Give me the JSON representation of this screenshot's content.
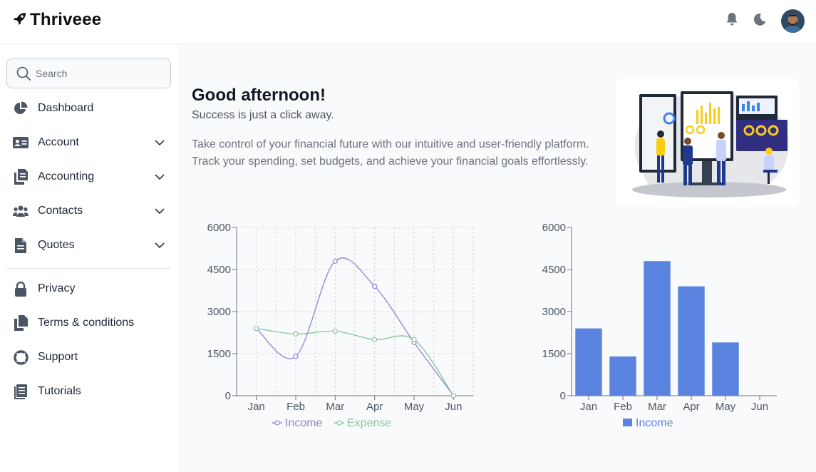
{
  "header": {
    "brand": "Thriveee",
    "icons": [
      "rocket-icon",
      "bell-icon",
      "moon-icon"
    ]
  },
  "sidebar": {
    "search_placeholder": "Search",
    "items": [
      {
        "label": "Dashboard",
        "icon": "pie-chart-icon",
        "expandable": false
      },
      {
        "label": "Account",
        "icon": "id-card-icon",
        "expandable": true
      },
      {
        "label": "Accounting",
        "icon": "documents-icon",
        "expandable": true
      },
      {
        "label": "Contacts",
        "icon": "users-icon",
        "expandable": true
      },
      {
        "label": "Quotes",
        "icon": "file-icon",
        "expandable": true
      },
      {
        "label": "Privacy",
        "icon": "lock-icon",
        "expandable": false
      },
      {
        "label": "Terms & conditions",
        "icon": "copy-icon",
        "expandable": false
      },
      {
        "label": "Support",
        "icon": "lifebuoy-icon",
        "expandable": false
      },
      {
        "label": "Tutorials",
        "icon": "book-icon",
        "expandable": false
      }
    ]
  },
  "main": {
    "greeting": "Good afternoon!",
    "tagline": "Success is just a click away.",
    "description": "Take control of your financial future with our intuitive and user-friendly platform. Track your spending, set budgets, and achieve your financial goals effortlessly."
  },
  "colors": {
    "income_line": "#8c84d6",
    "expense_line": "#82c69a",
    "income_bar": "#5b84e1"
  },
  "chart_data": [
    {
      "type": "line",
      "categories": [
        "Jan",
        "Feb",
        "Mar",
        "Apr",
        "May",
        "Jun"
      ],
      "series": [
        {
          "name": "Income",
          "values": [
            2400,
            1400,
            4800,
            3900,
            1900,
            0
          ]
        },
        {
          "name": "Expense",
          "values": [
            2400,
            2200,
            2300,
            2000,
            2000,
            0
          ]
        }
      ],
      "yticks": [
        "0",
        "1500",
        "3000",
        "4500",
        "6000"
      ],
      "ylim": [
        0,
        6000
      ],
      "grid": true,
      "legend": "bottom"
    },
    {
      "type": "bar",
      "categories": [
        "Jan",
        "Feb",
        "Mar",
        "Apr",
        "May",
        "Jun"
      ],
      "series": [
        {
          "name": "Income",
          "values": [
            2400,
            1400,
            4800,
            3900,
            1900,
            0
          ]
        }
      ],
      "yticks": [
        "0",
        "1500",
        "3000",
        "4500",
        "6000"
      ],
      "ylim": [
        0,
        6000
      ],
      "grid": false,
      "legend": "bottom"
    }
  ]
}
